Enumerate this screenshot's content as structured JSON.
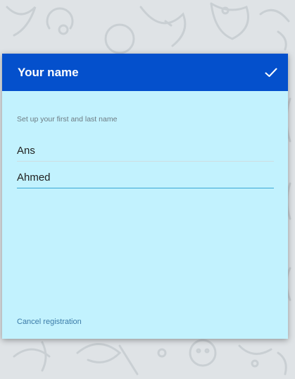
{
  "header": {
    "title": "Your name",
    "confirm_icon": "check-icon"
  },
  "form": {
    "hint": "Set up your first and last name",
    "first_name": "Ans",
    "last_name": "Ahmed"
  },
  "footer": {
    "cancel_label": "Cancel registration"
  },
  "colors": {
    "header": "#0450cc",
    "dialog": "#c2f2fe",
    "accent": "#3aa7d4",
    "link": "#3b7ba8"
  }
}
